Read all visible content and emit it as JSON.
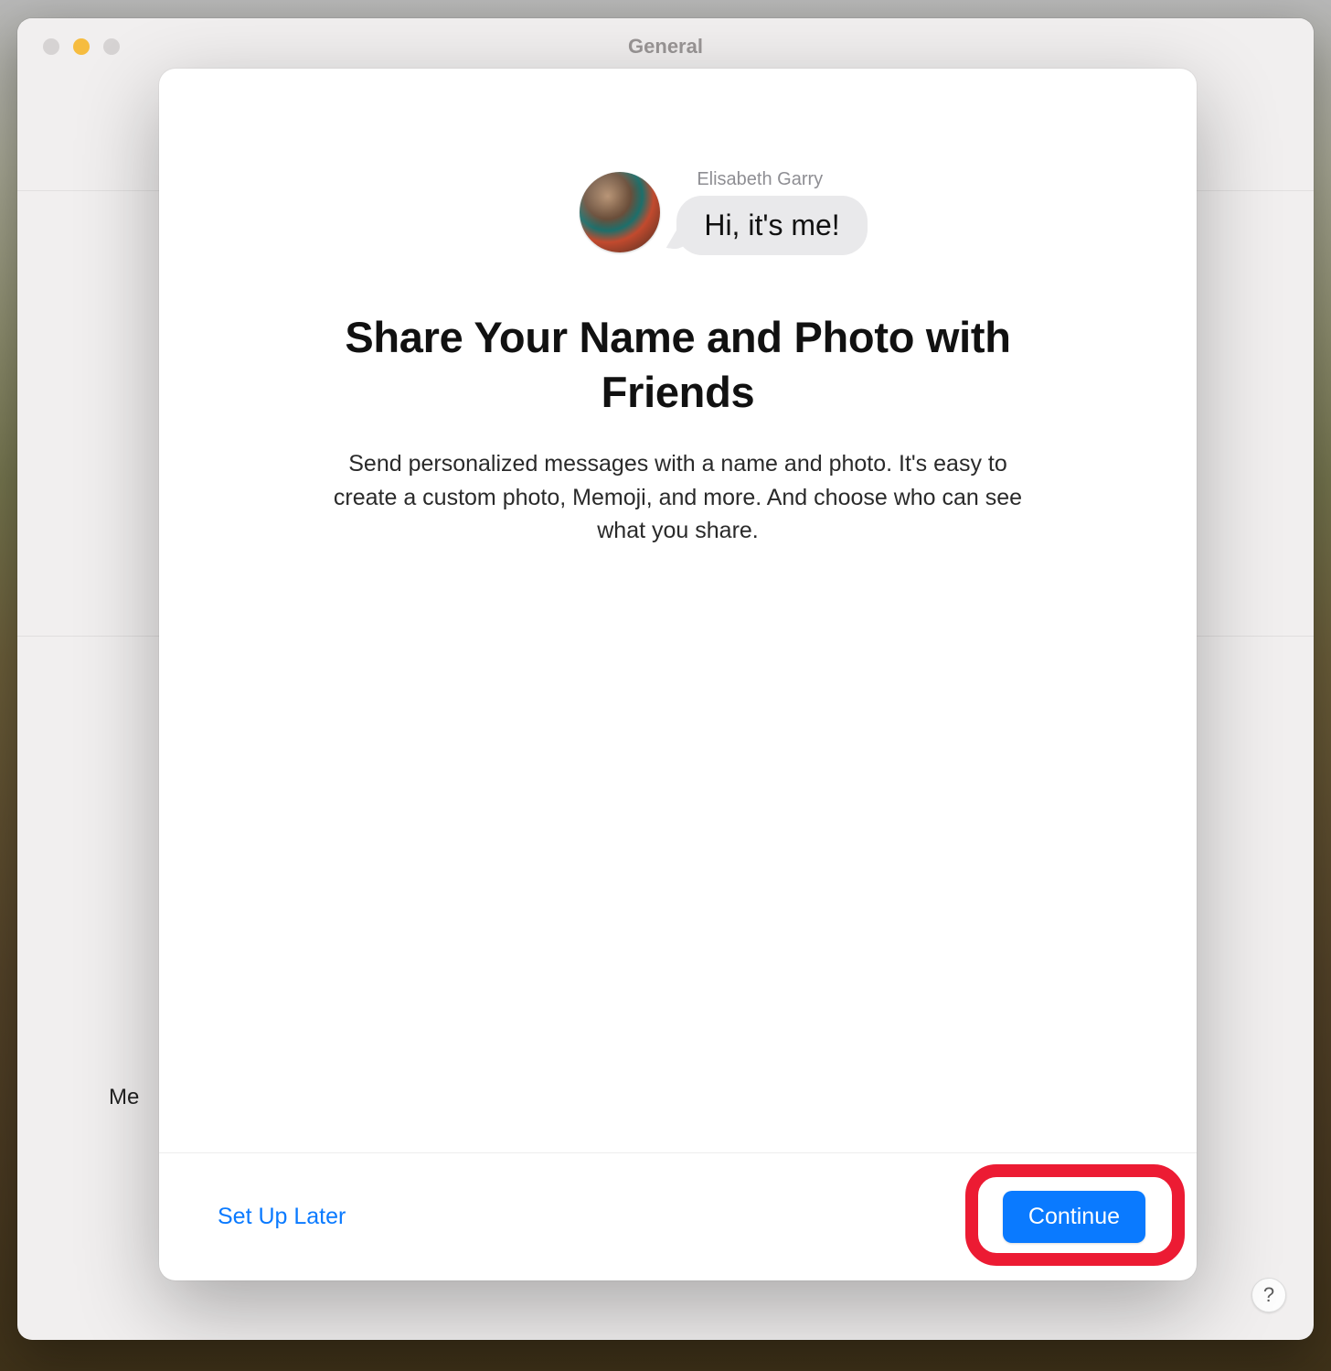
{
  "window": {
    "title": "General",
    "bg_partial_label": "Me",
    "help_glyph": "?"
  },
  "sheet": {
    "preview": {
      "name": "Elisabeth Garry",
      "bubble_text": "Hi, it's me!"
    },
    "headline": "Share Your Name and Photo with Friends",
    "subhead": "Send personalized messages with a name and photo. It's easy to create a custom photo, Memoji, and more. And choose who can see what you share.",
    "footer": {
      "later_label": "Set Up Later",
      "continue_label": "Continue"
    }
  },
  "colors": {
    "accent": "#0a7aff",
    "highlight_ring": "#ec1b33"
  }
}
